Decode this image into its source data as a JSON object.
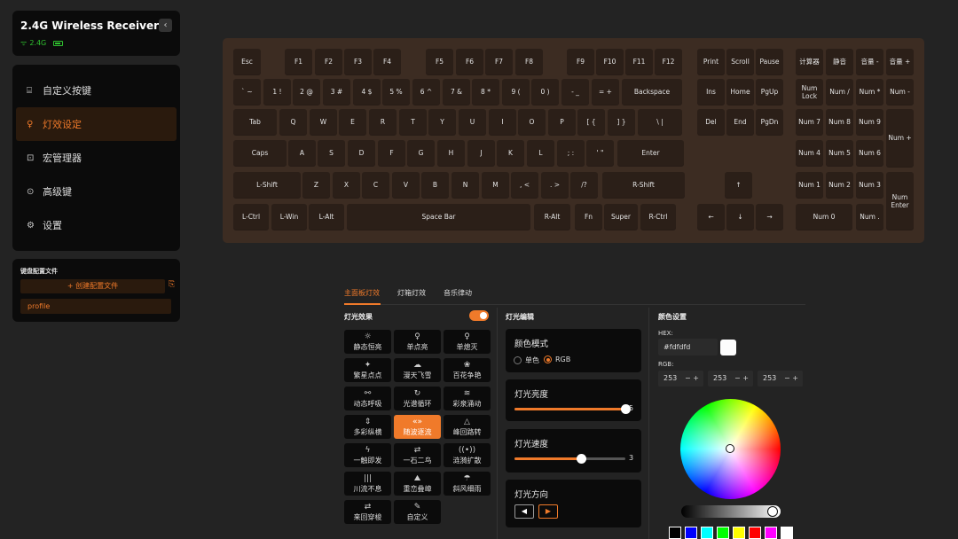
{
  "device": {
    "title": "2.4G Wireless Receiver",
    "conn": "2.4G",
    "collapse": "‹"
  },
  "menu": [
    {
      "label": "自定义按键",
      "icon": "keyboard-icon",
      "glyph": "⌸"
    },
    {
      "label": "灯效设定",
      "icon": "bulb-icon",
      "glyph": "♀"
    },
    {
      "label": "宏管理器",
      "icon": "macro-icon",
      "glyph": "⊡"
    },
    {
      "label": "高级键",
      "icon": "advanced-key-icon",
      "glyph": "⊙"
    },
    {
      "label": "设置",
      "icon": "gear-icon",
      "glyph": "⚙"
    }
  ],
  "profiles": {
    "header": "键盘配置文件",
    "create": "+ 创建配置文件",
    "import_icon": "⎘",
    "items": [
      "profile"
    ]
  },
  "keys": [
    [
      "Esc",
      "F1",
      "F2",
      "F3",
      "F4",
      "F5",
      "F6",
      "F7",
      "F8",
      "F9",
      "F10",
      "F11",
      "F12",
      "Print",
      "Scroll",
      "Pause",
      "计算器",
      "静音",
      "音量 -",
      "音量 +"
    ],
    [
      "` ~",
      "1 !",
      "2 @",
      "3 #",
      "4 $",
      "5 %",
      "6 ^",
      "7 &",
      "8 *",
      "9 (",
      "0 )",
      "- _",
      "= +",
      "Backspace",
      "Ins",
      "Home",
      "PgUp",
      "Num Lock",
      "Num /",
      "Num *",
      "Num -"
    ],
    [
      "Tab",
      "Q",
      "W",
      "E",
      "R",
      "T",
      "Y",
      "U",
      "I",
      "O",
      "P",
      "[ {",
      "] }",
      "\\ |",
      "Del",
      "End",
      "PgDn",
      "Num 7",
      "Num 8",
      "Num 9",
      "Num +"
    ],
    [
      "Caps",
      "A",
      "S",
      "D",
      "F",
      "G",
      "H",
      "J",
      "K",
      "L",
      "; :",
      "' \"",
      "Enter",
      "Num 4",
      "Num 5",
      "Num 6"
    ],
    [
      "L-Shift",
      "Z",
      "X",
      "C",
      "V",
      "B",
      "N",
      "M",
      ", <",
      ". >",
      "/?",
      "R-Shift",
      "↑",
      "Num 1",
      "Num 2",
      "Num 3",
      "Num Enter"
    ],
    [
      "L-Ctrl",
      "L-Win",
      "L-Alt",
      "Space Bar",
      "R-Alt",
      "Fn",
      "Super",
      "R-Ctrl",
      "←",
      "↓",
      "→",
      "Num 0",
      "Num ."
    ]
  ],
  "tabs": [
    "主面板灯效",
    "灯箱灯效",
    "音乐律动"
  ],
  "effects": {
    "title": "灯光效果",
    "items": [
      {
        "label": "静态恒亮",
        "icon": "sun-icon",
        "glyph": "☼"
      },
      {
        "label": "单点亮",
        "icon": "bulb-icon",
        "glyph": "♀"
      },
      {
        "label": "单熄灭",
        "icon": "bulb-off-icon",
        "glyph": "♀"
      },
      {
        "label": "繁星点点",
        "icon": "stars-icon",
        "glyph": "✦"
      },
      {
        "label": "漫天飞雪",
        "icon": "snow-cloud-icon",
        "glyph": "☁"
      },
      {
        "label": "百花争艳",
        "icon": "flower-icon",
        "glyph": "❀"
      },
      {
        "label": "动态呼吸",
        "icon": "breath-icon",
        "glyph": "⚯"
      },
      {
        "label": "光谱循环",
        "icon": "cycle-icon",
        "glyph": "↻"
      },
      {
        "label": "彩泉涌动",
        "icon": "fountain-icon",
        "glyph": "≋"
      },
      {
        "label": "多彩纵横",
        "icon": "updown-icon",
        "glyph": "⇕"
      },
      {
        "label": "随波逐流",
        "icon": "wave-icon",
        "glyph": "«»"
      },
      {
        "label": "峰回路转",
        "icon": "peak-icon",
        "glyph": "△"
      },
      {
        "label": "一触即发",
        "icon": "lightning-icon",
        "glyph": "ϟ"
      },
      {
        "label": "一石二鸟",
        "icon": "swap-icon",
        "glyph": "⇄"
      },
      {
        "label": "涟漪扩散",
        "icon": "ripple-icon",
        "glyph": "((•))"
      },
      {
        "label": "川流不息",
        "icon": "stream-icon",
        "glyph": "|||"
      },
      {
        "label": "重峦叠嶂",
        "icon": "mountain-icon",
        "glyph": "⛰"
      },
      {
        "label": "斜风细雨",
        "icon": "rain-icon",
        "glyph": "☂"
      },
      {
        "label": "来回穿梭",
        "icon": "shuttle-icon",
        "glyph": "⇄"
      },
      {
        "label": "自定义",
        "icon": "edit-icon",
        "glyph": "✎"
      }
    ]
  },
  "edit": {
    "title": "灯光编辑",
    "mode_title": "颜色模式",
    "mode_single": "单色",
    "mode_rgb": "RGB",
    "brightness_title": "灯光亮度",
    "brightness": 5,
    "brightness_max": 5,
    "speed_title": "灯光速度",
    "speed": 3,
    "speed_max": 5,
    "direction_title": "灯光方向",
    "dir_left": "◀",
    "dir_right": "▶"
  },
  "color": {
    "title": "颜色设置",
    "hex_label": "HEX:",
    "hex": "#fdfdfd",
    "rgb_label": "RGB:",
    "r": "253",
    "g": "253",
    "b": "253",
    "pm": "− +",
    "swatches": [
      "#000000",
      "#0000ff",
      "#00ffff",
      "#00ff00",
      "#ffff00",
      "#ff0000",
      "#ff00ff",
      "#ffffff"
    ]
  }
}
